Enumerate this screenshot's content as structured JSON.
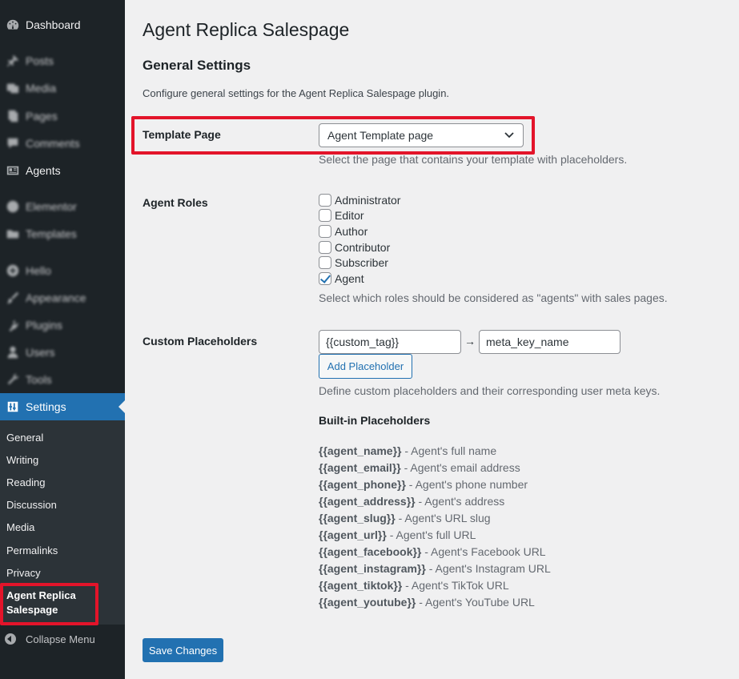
{
  "sidebar": {
    "items": [
      {
        "label": "Dashboard",
        "icon": "dashboard-icon"
      },
      {
        "label": "Posts",
        "icon": "pin-icon"
      },
      {
        "label": "Media",
        "icon": "media-icon"
      },
      {
        "label": "Pages",
        "icon": "pages-icon"
      },
      {
        "label": "Comments",
        "icon": "comments-icon"
      },
      {
        "label": "Agents",
        "icon": "id-card-icon"
      },
      {
        "label": "Elementor",
        "icon": "elementor-icon"
      },
      {
        "label": "Templates",
        "icon": "folder-icon"
      },
      {
        "label": "Hello",
        "icon": "plus-circle-icon"
      },
      {
        "label": "Appearance",
        "icon": "brush-icon"
      },
      {
        "label": "Plugins",
        "icon": "plugin-icon"
      },
      {
        "label": "Users",
        "icon": "user-icon"
      },
      {
        "label": "Tools",
        "icon": "wrench-icon"
      },
      {
        "label": "Settings",
        "icon": "settings-icon"
      }
    ],
    "submenu": [
      "General",
      "Writing",
      "Reading",
      "Discussion",
      "Media",
      "Permalinks",
      "Privacy"
    ],
    "current_submenu": "Agent Replica Salespage",
    "current_submenu_lines": [
      "Agent Replica",
      "Salespage"
    ],
    "collapse_label": "Collapse Menu"
  },
  "main": {
    "page_title": "Agent Replica Salespage",
    "section_title": "General Settings",
    "section_desc": "Configure general settings for the Agent Replica Salespage plugin.",
    "template_page": {
      "label": "Template Page",
      "selected": "Agent Template page",
      "help": "Select the page that contains your template with placeholders."
    },
    "agent_roles": {
      "label": "Agent Roles",
      "roles": [
        {
          "name": "Administrator",
          "checked": false
        },
        {
          "name": "Editor",
          "checked": false
        },
        {
          "name": "Author",
          "checked": false
        },
        {
          "name": "Contributor",
          "checked": false
        },
        {
          "name": "Subscriber",
          "checked": false
        },
        {
          "name": "Agent",
          "checked": true
        }
      ],
      "help": "Select which roles should be considered as \"agents\" with sales pages."
    },
    "custom_placeholders": {
      "label": "Custom Placeholders",
      "tag_value": "{{custom_tag}}",
      "arrow": "→",
      "meta_value": "meta_key_name",
      "add_button": "Add Placeholder",
      "help": "Define custom placeholders and their corresponding user meta keys."
    },
    "builtin": {
      "title": "Built-in Placeholders",
      "items": [
        {
          "tag": "{{agent_name}}",
          "desc": " - Agent's full name"
        },
        {
          "tag": "{{agent_email}}",
          "desc": " - Agent's email address"
        },
        {
          "tag": "{{agent_phone}}",
          "desc": " - Agent's phone number"
        },
        {
          "tag": "{{agent_address}}",
          "desc": " - Agent's address"
        },
        {
          "tag": "{{agent_slug}}",
          "desc": " - Agent's URL slug"
        },
        {
          "tag": "{{agent_url}}",
          "desc": " - Agent's full URL"
        },
        {
          "tag": "{{agent_facebook}}",
          "desc": " - Agent's Facebook URL"
        },
        {
          "tag": "{{agent_instagram}}",
          "desc": " - Agent's Instagram URL"
        },
        {
          "tag": "{{agent_tiktok}}",
          "desc": " - Agent's TikTok URL"
        },
        {
          "tag": "{{agent_youtube}}",
          "desc": " - Agent's YouTube URL"
        }
      ]
    },
    "save_button": "Save Changes"
  },
  "colors": {
    "sidebar_bg": "#1d2327",
    "accent": "#2271b1",
    "highlight": "#e3142a"
  }
}
